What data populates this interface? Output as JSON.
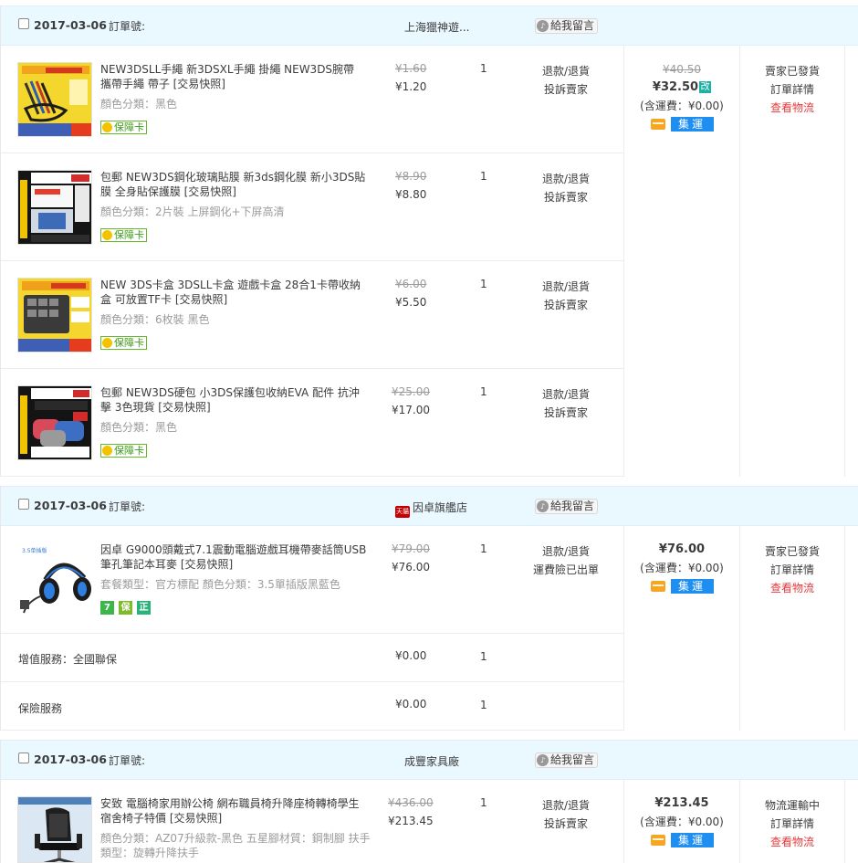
{
  "orders": [
    {
      "date": "2017-03-06",
      "order_label": "訂單號:",
      "shop": "上海獵神遊...",
      "message_button": "給我留言",
      "items": [
        {
          "title": "NEW3DSLL手繩 新3DSXL手繩 掛繩 NEW3DS腕帶 攜帶手繩 帶子 [交易快照]",
          "sku": "顏色分類：黑色",
          "badge": "保障卡",
          "price_old": "¥1.60",
          "price_new": "¥1.20",
          "qty": "1",
          "actions": [
            "退款/退貨",
            "投訴賣家"
          ]
        },
        {
          "title": "包郵 NEW3DS鋼化玻璃貼膜 新3ds鋼化膜 新小3DS貼膜 全身貼保護膜 [交易快照]",
          "sku": "顏色分類：2片裝 上屏鋼化+下屏高清",
          "badge": "保障卡",
          "price_old": "¥8.90",
          "price_new": "¥8.80",
          "qty": "1",
          "actions": [
            "退款/退貨",
            "投訴賣家"
          ]
        },
        {
          "title": "NEW 3DS卡盒 3DSLL卡盒 遊戲卡盒 28合1卡帶收納盒 可放置TF卡 [交易快照]",
          "sku": "顏色分類：6枚裝 黑色",
          "badge": "保障卡",
          "price_old": "¥6.00",
          "price_new": "¥5.50",
          "qty": "1",
          "actions": [
            "退款/退貨",
            "投訴賣家"
          ]
        },
        {
          "title": "包郵 NEW3DS硬包 小3DS保護包收納EVA 配件 抗沖擊 3色現貨 [交易快照]",
          "sku": "顏色分類：黑色",
          "badge": "保障卡",
          "price_old": "¥25.00",
          "price_new": "¥17.00",
          "qty": "1",
          "actions": [
            "退款/退貨",
            "投訴賣家"
          ]
        }
      ],
      "total_old": "¥40.50",
      "total": "¥32.50",
      "edit_tag": "改",
      "shipping": "(含運費：¥0.00)",
      "jiyun": "集運",
      "status": [
        "賣家已發貨",
        "訂單詳情"
      ],
      "logistics": "查看物流"
    },
    {
      "date": "2017-03-06",
      "order_label": "訂單號:",
      "shop_icon": "天貓",
      "shop": "因卓旗艦店",
      "message_button": "給我留言",
      "items": [
        {
          "title": "因卓 G9000頭戴式7.1震動電腦遊戲耳機帶麥話筒USB筆孔筆記本耳麥 [交易快照]",
          "sku": "套餐類型：官方標配   顏色分類：3.5單插版黑藍色",
          "badges": [
            "7",
            "保",
            "正"
          ],
          "price_old": "¥79.00",
          "price_new": "¥76.00",
          "qty": "1",
          "actions": [
            "退款/退貨",
            "運費險已出單"
          ]
        }
      ],
      "services": [
        {
          "label": "增值服務：全國聯保",
          "price": "¥0.00",
          "qty": "1"
        },
        {
          "label": "保險服務",
          "price": "¥0.00",
          "qty": "1"
        }
      ],
      "total": "¥76.00",
      "shipping": "(含運費：¥0.00)",
      "jiyun": "集運",
      "status": [
        "賣家已發貨",
        "訂單詳情"
      ],
      "logistics": "查看物流"
    },
    {
      "date": "2017-03-06",
      "order_label": "訂單號:",
      "shop": "成豐家具廠",
      "message_button": "給我留言",
      "items": [
        {
          "title": "安致 電腦椅家用辦公椅 網布職員椅升降座椅轉椅學生宿舍椅子特價 [交易快照]",
          "sku": "顏色分類：AZ07升級款-黑色  五星腳材質：鋼制腳  扶手類型：旋轉升降扶手",
          "price_old": "¥436.00",
          "price_new": "¥213.45",
          "qty": "1",
          "actions": [
            "退款/退貨",
            "投訴賣家"
          ]
        }
      ],
      "total": "¥213.45",
      "shipping": "(含運費：¥0.00)",
      "jiyun": "集運",
      "status": [
        "物流運輸中",
        "訂單詳情"
      ],
      "logistics": "查看物流"
    }
  ],
  "colors": {
    "header_bg": "#eaf8ff",
    "link_red": "#e4393c",
    "jiyun_blue": "#1e8ff0",
    "edit_teal": "#1cb1a7",
    "guarantee_green": "#3f9a1a"
  }
}
